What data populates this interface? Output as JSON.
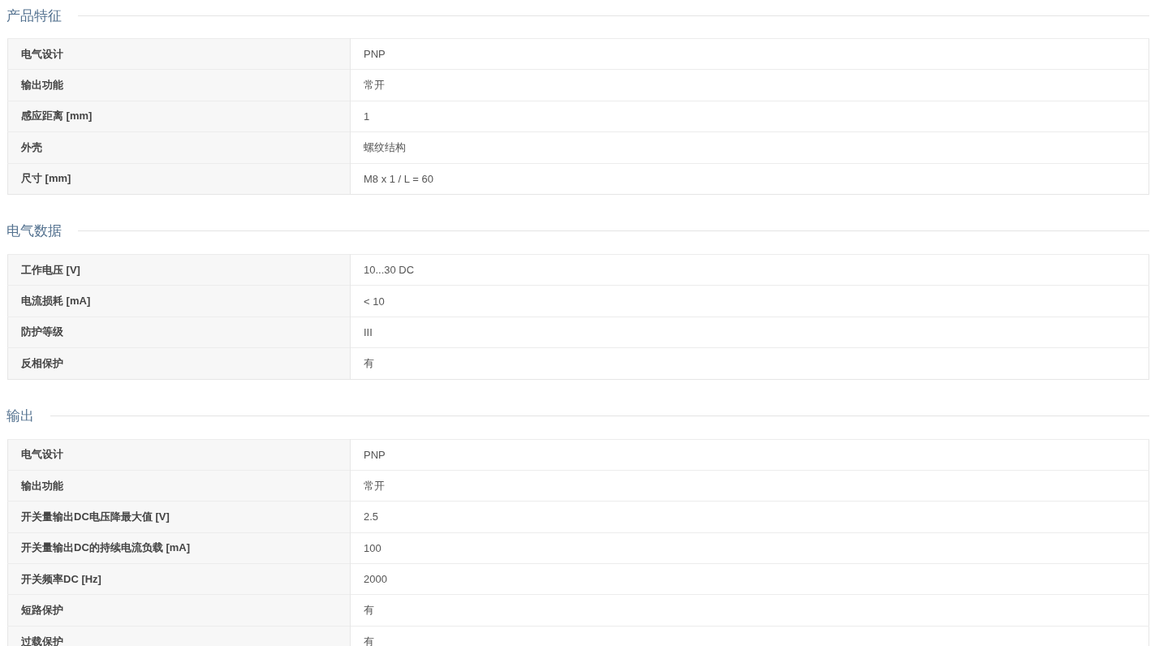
{
  "sections": [
    {
      "title": "产品特征",
      "rows": [
        {
          "label": "电气设计",
          "value": "PNP"
        },
        {
          "label": "输出功能",
          "value": "常开"
        },
        {
          "label": "感应距离 [mm]",
          "value": "1"
        },
        {
          "label": "外壳",
          "value": "螺纹结构"
        },
        {
          "label": "尺寸 [mm]",
          "value": "M8 x 1 / L = 60"
        }
      ]
    },
    {
      "title": "电气数据",
      "rows": [
        {
          "label": "工作电压 [V]",
          "value": "10...30 DC"
        },
        {
          "label": "电流损耗 [mA]",
          "value": "< 10"
        },
        {
          "label": "防护等级",
          "value": "III"
        },
        {
          "label": "反相保护",
          "value": "有"
        }
      ]
    },
    {
      "title": "输出",
      "rows": [
        {
          "label": "电气设计",
          "value": "PNP"
        },
        {
          "label": "输出功能",
          "value": "常开"
        },
        {
          "label": "开关量输出DC电压降最大值 [V]",
          "value": "2.5"
        },
        {
          "label": "开关量输出DC的持续电流负载 [mA]",
          "value": "100"
        },
        {
          "label": "开关频率DC [Hz]",
          "value": "2000"
        },
        {
          "label": "短路保护",
          "value": "有"
        },
        {
          "label": "过载保护",
          "value": "有"
        }
      ]
    }
  ]
}
